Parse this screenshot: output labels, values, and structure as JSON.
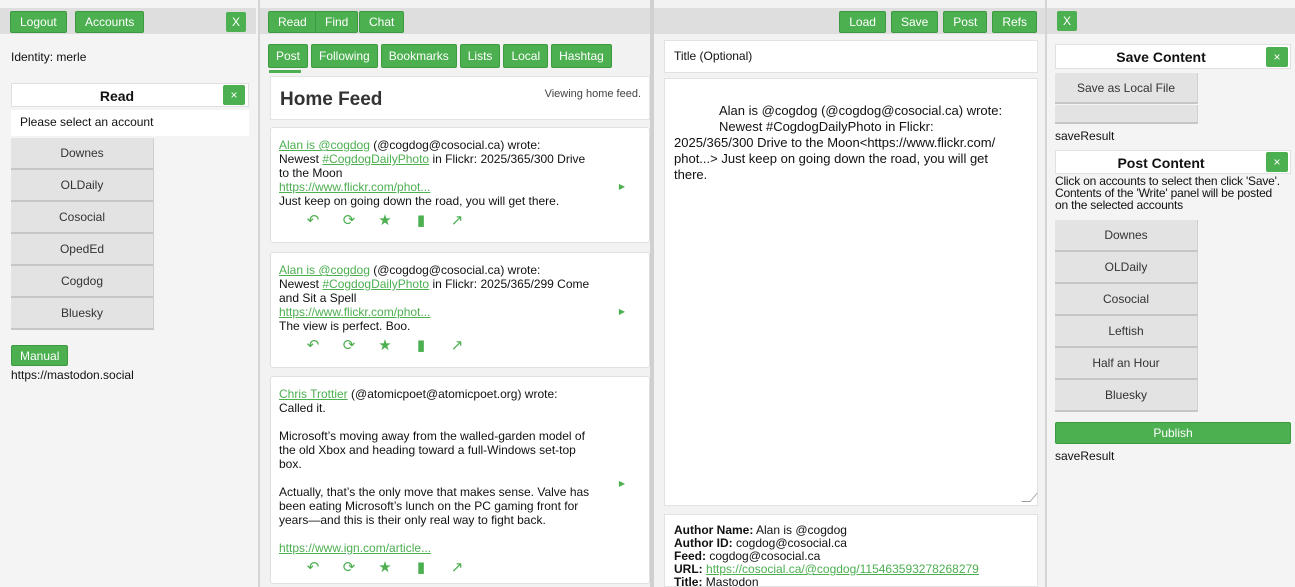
{
  "left": {
    "logout": "Logout",
    "accounts": "Accounts",
    "close": "X",
    "identity": "Identity: merle",
    "read_title": "Read",
    "read_close": "×",
    "select_prompt": "Please select an account",
    "accounts_list": [
      "Downes",
      "OLDaily",
      "Cosocial",
      "OpedEd",
      "Cogdog",
      "Bluesky"
    ],
    "manual": "Manual",
    "instance": "https://mastodon.social"
  },
  "feed": {
    "top_buttons": [
      "Read",
      "Find",
      "Chat"
    ],
    "tabs": [
      "Post",
      "Following",
      "Bookmarks",
      "Lists",
      "Local",
      "Hashtag"
    ],
    "title": "Home Feed",
    "status": "Viewing home feed.",
    "posts": [
      {
        "author": "Alan is @cogdog",
        "handle": " (@cogdog@cosocial.ca) wrote:",
        "line1_pre": "Newest ",
        "hashtag": "#CogdogDailyPhoto",
        "line1_post": " in Flickr: 2025/365/300 Drive",
        "line2": "to the Moon",
        "url": "https://www.flickr.com/phot...",
        "body": "Just keep on going down the road, you will get there."
      },
      {
        "author": "Alan is @cogdog",
        "handle": " (@cogdog@cosocial.ca) wrote:",
        "line1_pre": "Newest ",
        "hashtag": "#CogdogDailyPhoto",
        "line1_post": " in Flickr: 2025/365/299 Come",
        "line2": "and Sit a Spell",
        "url": "https://www.flickr.com/phot...",
        "body": "The view is perfect. Boo."
      },
      {
        "author": "Chris Trottier",
        "handle": " (@atomicpoet@atomicpoet.org) wrote:",
        "line_a": "Called it.",
        "para1": [
          "Microsoft’s moving away from the walled-garden model of",
          "the old Xbox and heading toward a full-Windows set-top",
          "box."
        ],
        "para2": [
          "Actually, that’s the only move that makes sense. Valve has",
          "been eating Microsoft’s lunch on the PC gaming front for",
          "years—and this is their only real way to fight back."
        ],
        "url": "https://www.ign.com/article..."
      }
    ]
  },
  "write": {
    "top_buttons": [
      "Load",
      "Save",
      "Post",
      "Refs"
    ],
    "title_placeholder": "Title (Optional)",
    "content": [
      "Alan is @cogdog  (@cogdog@cosocial.ca) wrote:",
      "Newest #CogdogDailyPhoto  in Flickr:",
      "2025/365/300 Drive to the Moon<https://www.flickr.com/",
      "phot...>    Just keep on going down the road, you will get",
      "there."
    ],
    "meta": {
      "author_name_label": "Author Name:",
      "author_name": " Alan is @cogdog",
      "author_id_label": "Author ID:",
      "author_id": " cogdog@cosocial.ca",
      "feed_label": "Feed:",
      "feed": " cogdog@cosocial.ca",
      "url_label": "URL:",
      "url": "https://cosocial.ca/@cogdog/115463593278268279",
      "title_label": "Title:",
      "title": " Mastodon"
    }
  },
  "right": {
    "close": "X",
    "save_title": "Save Content",
    "save_close": "×",
    "save_local": "Save as Local File",
    "save_result_1": "saveResult",
    "post_title": "Post Content",
    "post_close": "×",
    "instructions": [
      "Click on accounts to select then click 'Save'.",
      "Contents of the 'Write' panel will be posted",
      "on the selected accounts"
    ],
    "accounts_list": [
      "Downes",
      "OLDaily",
      "Cosocial",
      "Leftish",
      "Half an Hour",
      "Bluesky"
    ],
    "publish": "Publish",
    "save_result_2": "saveResult"
  },
  "icons": [
    "reply-icon",
    "boost-icon",
    "star-icon",
    "bookmark-icon",
    "open-external-icon"
  ],
  "colors": {
    "accent": "#4caf50",
    "panel": "#f2f2f2",
    "button_grey": "#e3e3e3"
  }
}
